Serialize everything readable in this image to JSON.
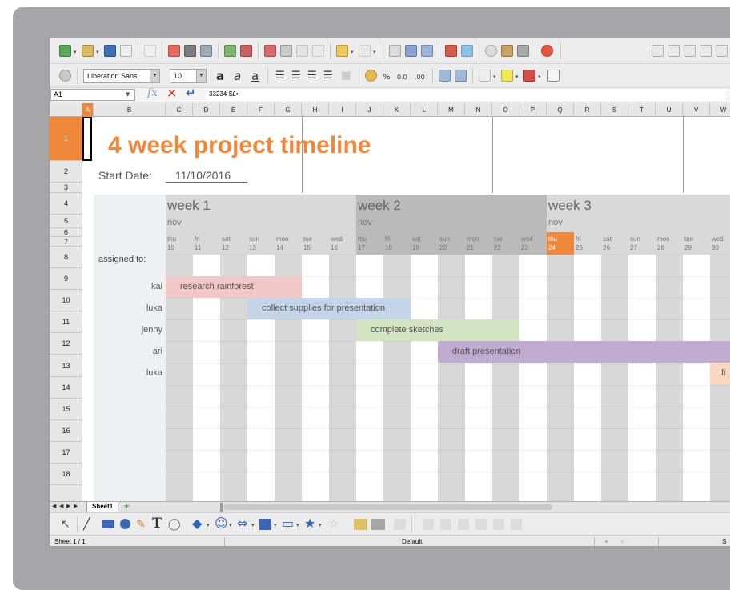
{
  "toolbar": {
    "font_name": "Liberation Sans",
    "font_size": "10"
  },
  "formula_bar": {
    "cell_ref": "A1",
    "content": "33234-$£•"
  },
  "columns": [
    "A",
    "B",
    "C",
    "D",
    "E",
    "F",
    "G",
    "H",
    "I",
    "J",
    "K",
    "L",
    "M",
    "N",
    "O",
    "P",
    "Q",
    "R",
    "S",
    "T",
    "U",
    "V",
    "W"
  ],
  "rows": [
    "1",
    "2",
    "3",
    "4",
    "5",
    "6",
    "7",
    "8",
    "9",
    "10",
    "11",
    "12",
    "13",
    "14",
    "15",
    "16",
    "17",
    "18"
  ],
  "sheet": {
    "title": "4 week project timeline",
    "start_date_label": "Start Date:",
    "start_date_value": "11/10/2016",
    "assigned_label": "assigned to:",
    "accent_color": "#f0883c",
    "weeks": [
      {
        "label": "week 1",
        "month": "nov"
      },
      {
        "label": "week 2",
        "month": "nov"
      },
      {
        "label": "week 3",
        "month": "nov"
      }
    ],
    "days": [
      {
        "day": "thu",
        "date": "10"
      },
      {
        "day": "fri",
        "date": "11"
      },
      {
        "day": "sat",
        "date": "12"
      },
      {
        "day": "sun",
        "date": "13"
      },
      {
        "day": "mon",
        "date": "14"
      },
      {
        "day": "tue",
        "date": "15"
      },
      {
        "day": "wed",
        "date": "16"
      },
      {
        "day": "thu",
        "date": "17"
      },
      {
        "day": "fri",
        "date": "18"
      },
      {
        "day": "sat",
        "date": "19"
      },
      {
        "day": "sun",
        "date": "20"
      },
      {
        "day": "mon",
        "date": "21"
      },
      {
        "day": "tue",
        "date": "22"
      },
      {
        "day": "wed",
        "date": "23"
      },
      {
        "day": "thu",
        "date": "24"
      },
      {
        "day": "fri",
        "date": "25"
      },
      {
        "day": "sat",
        "date": "26"
      },
      {
        "day": "sun",
        "date": "27"
      },
      {
        "day": "mon",
        "date": "28"
      },
      {
        "day": "tue",
        "date": "29"
      },
      {
        "day": "wed",
        "date": "30"
      }
    ],
    "highlighted_day_index": 14,
    "tasks": [
      {
        "assignee": "kai",
        "task": "research rainforest",
        "start": 0,
        "span": 5,
        "color": "#f2c7c7"
      },
      {
        "assignee": "luka",
        "task": "collect supplies for presentation",
        "start": 3,
        "span": 6,
        "color": "#c4d5ea"
      },
      {
        "assignee": "jenny",
        "task": "complete sketches",
        "start": 7,
        "span": 6,
        "color": "#d3e4c2"
      },
      {
        "assignee": "ari",
        "task": "draft presentation",
        "start": 10,
        "span": 11,
        "color": "#c1acd1"
      },
      {
        "assignee": "luka",
        "task": "fi",
        "start": 20,
        "span": 1,
        "color": "#fad8bd"
      }
    ]
  },
  "tabs": {
    "sheet_name": "Sheet1"
  },
  "status": {
    "sheet_pos": "Sheet 1 / 1",
    "page_style": "Default",
    "right_text": "S"
  }
}
